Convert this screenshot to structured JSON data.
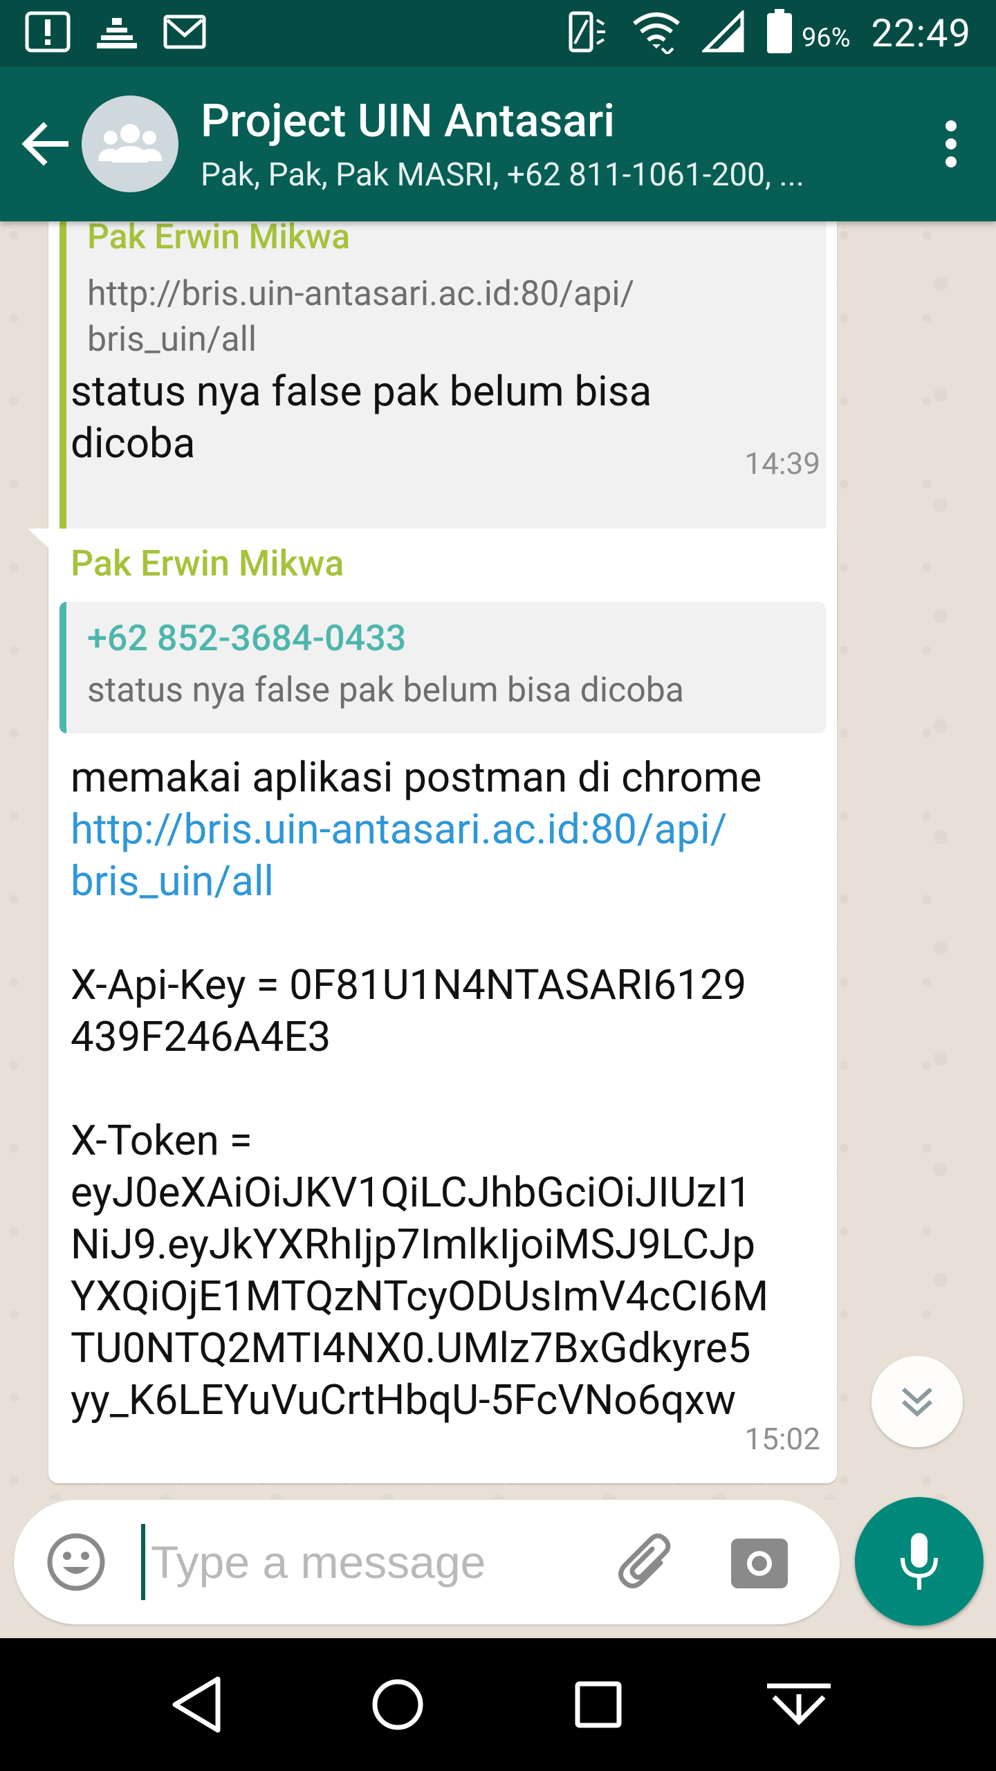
{
  "status_bar": {
    "battery_percent": "96%",
    "time": "22:49",
    "icons": [
      "alert-icon",
      "chart-icon",
      "mail-icon",
      "vibrate-icon",
      "wifi-icon",
      "signal-icon",
      "battery-icon"
    ]
  },
  "header": {
    "title": "Project UIN Antasari",
    "subtitle": "Pak, Pak, Pak MASRI, +62 811-1061-200, ..."
  },
  "messages": [
    {
      "quote_author": "Pak Erwin Mikwa",
      "quote_text": "http://bris.uin-antasari.ac.id:80/api/\nbris_uin/all",
      "text": "status nya false pak belum bisa\ndicoba",
      "time": "14:39"
    },
    {
      "sender": "Pak Erwin Mikwa",
      "quote_author": "+62 852-3684-0433",
      "quote_text": "status nya false pak belum bisa dicoba",
      "text_line1": "memakai aplikasi postman di chrome",
      "link": "http://bris.uin-antasari.ac.id:80/api/\nbris_uin/all",
      "text_rest": "\n\nX-Api-Key = 0F81U1N4NTASARI6129\n439F246A4E3\n\nX-Token =\neyJ0eXAiOiJKV1QiLCJhbGciOiJIUzI1\nNiJ9.eyJkYXRhIjp7ImlkIjoiMSJ9LCJp\nYXQiOjE1MTQzNTcyODUsImV4cCI6M\nTU0NTQ2MTI4NX0.UMlz7BxGdkyre5\nyy_K6LEYuVuCrtHbqU-5FcVNo6qxw",
      "time": "15:02"
    }
  ],
  "input": {
    "placeholder": "Type a message"
  },
  "colors": {
    "header": "#075e54",
    "status_bar": "#054d44",
    "accent": "#00897b",
    "sender_name": "#a5c23a",
    "link": "#2f97d7"
  }
}
